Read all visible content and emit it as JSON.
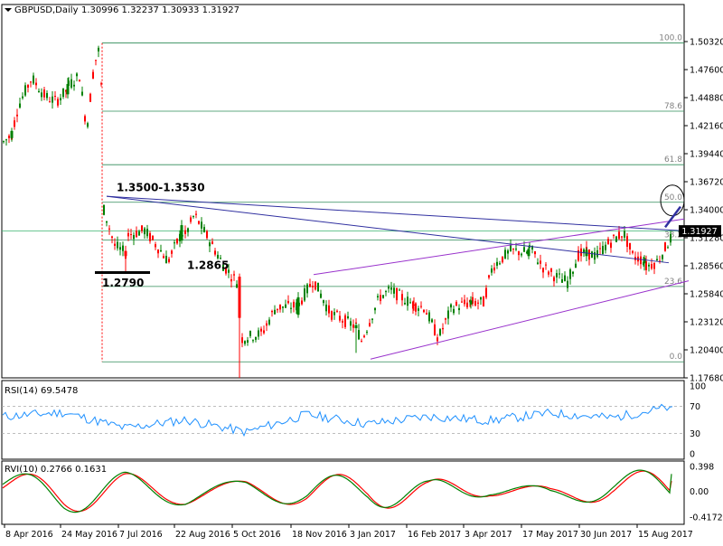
{
  "colors": {
    "background": "#ffffff",
    "frame": "#000000",
    "candle_up": "#008000",
    "candle_down": "#ff0000",
    "fib_line": "#2e8b57",
    "fib_text": "#808080",
    "trend_blue": "#3030a0",
    "channel_purple": "#9932cc",
    "price_line": "#3cb371",
    "price_tag_bg": "#000000",
    "price_tag_text": "#ffffff",
    "rsi_line": "#1e90ff",
    "rvi_main": "#008000",
    "rvi_signal": "#ff0000",
    "level_dash": "#a9a9a9"
  },
  "header": {
    "symbol": "GBPUSD,Daily",
    "ohlc": "1.30996 1.32237 1.30933 1.31927"
  },
  "chart_data": [
    {
      "type": "candlestick",
      "title": "GBPUSD,Daily",
      "ylim": [
        1.1768,
        1.526
      ],
      "y_ticks": [
        "1.50320",
        "1.47600",
        "1.44880",
        "1.42160",
        "1.39440",
        "1.36720",
        "1.34000",
        "1.31280",
        "1.28560",
        "1.25840",
        "1.23120",
        "1.20400",
        "1.17680"
      ],
      "y_tick_values": [
        1.5032,
        1.476,
        1.4488,
        1.4216,
        1.3944,
        1.3672,
        1.34,
        1.3128,
        1.2856,
        1.2584,
        1.2312,
        1.204,
        1.1768
      ],
      "x_labels": [
        "8 Apr 2016",
        "24 May 2016",
        "7 Jul 2016",
        "22 Aug 2016",
        "5 Oct 2016",
        "18 Nov 2016",
        "3 Jan 2017",
        "16 Feb 2017",
        "3 Apr 2017",
        "17 May 2017",
        "30 Jun 2017",
        "15 Aug 2017"
      ],
      "current_price": 1.31927,
      "current_price_label": "1.31927",
      "fibonacci": [
        {
          "label": "100.0",
          "value": 1.5018
        },
        {
          "label": "78.6",
          "value": 1.4356
        },
        {
          "label": "61.8",
          "value": 1.3837
        },
        {
          "label": "50.0",
          "value": 1.3472
        },
        {
          "label": "38.2",
          "value": 1.3107
        },
        {
          "label": "23.6",
          "value": 1.2655
        },
        {
          "label": "0.0",
          "value": 1.1924
        }
      ],
      "annotations": [
        {
          "text": "1.3500-1.3530",
          "x": "7 Jul 2016",
          "y": 1.358
        },
        {
          "text": "1.2865",
          "x": "22 Aug 2016",
          "y": 1.2825
        },
        {
          "text": "1.2790",
          "x": "7 Jul 2016",
          "y": 1.2655
        }
      ],
      "candles": [
        {
          "date": "8 Apr 2016",
          "open": 1.4095,
          "high": 1.4195,
          "low": 1.406,
          "close": 1.4165
        },
        {
          "date": "24 May 2016",
          "open": 1.452,
          "high": 1.468,
          "low": 1.448,
          "close": 1.462
        },
        {
          "date": "7 Jul 2016",
          "open": 1.3,
          "high": 1.305,
          "low": 1.279,
          "close": 1.295
        },
        {
          "date": "22 Aug 2016",
          "open": 1.31,
          "high": 1.33,
          "low": 1.307,
          "close": 1.325
        },
        {
          "date": "5 Oct 2016",
          "open": 1.275,
          "high": 1.278,
          "low": 1.1768,
          "close": 1.235
        },
        {
          "date": "18 Nov 2016",
          "open": 1.238,
          "high": 1.26,
          "low": 1.235,
          "close": 1.255
        },
        {
          "date": "3 Jan 2017",
          "open": 1.225,
          "high": 1.23,
          "low": 1.201,
          "close": 1.228
        },
        {
          "date": "16 Feb 2017",
          "open": 1.248,
          "high": 1.255,
          "low": 1.242,
          "close": 1.247
        },
        {
          "date": "3 Apr 2017",
          "open": 1.248,
          "high": 1.256,
          "low": 1.244,
          "close": 1.252
        },
        {
          "date": "17 May 2017",
          "open": 1.295,
          "high": 1.305,
          "low": 1.292,
          "close": 1.302
        },
        {
          "date": "30 Jun 2017",
          "open": 1.295,
          "high": 1.303,
          "low": 1.29,
          "close": 1.301
        },
        {
          "date": "15 Aug 2017",
          "open": 1.288,
          "high": 1.296,
          "low": 1.281,
          "close": 1.293
        }
      ]
    },
    {
      "type": "line",
      "title": "RSI(14) 69.5478",
      "ylim": [
        0,
        100
      ],
      "y_ticks": [
        "100",
        "70",
        "30",
        "0"
      ],
      "y_tick_values": [
        100,
        70,
        30,
        0
      ],
      "levels": [
        70,
        30
      ],
      "series": [
        {
          "name": "RSI(14)",
          "values": [
            55,
            61,
            38,
            50,
            32,
            58,
            44,
            55,
            49,
            60,
            53,
            69.5478
          ]
        }
      ]
    },
    {
      "type": "line",
      "title": "RVI(10) 0.2766 0.1631",
      "ylim": [
        -0.4172,
        0.398
      ],
      "y_ticks": [
        "0.398",
        "0.00",
        "-0.4172"
      ],
      "y_tick_values": [
        0.398,
        0.0,
        -0.4172
      ],
      "series": [
        {
          "name": "RVI main",
          "values": [
            0.3,
            -0.25,
            0.22,
            -0.3,
            0.28,
            -0.32,
            0.3,
            -0.28,
            0.32,
            -0.3,
            0.25,
            0.2766
          ]
        },
        {
          "name": "RVI signal",
          "values": [
            0.25,
            -0.2,
            0.18,
            -0.26,
            0.24,
            -0.28,
            0.26,
            -0.24,
            0.28,
            -0.26,
            0.2,
            0.1631
          ]
        }
      ]
    }
  ]
}
